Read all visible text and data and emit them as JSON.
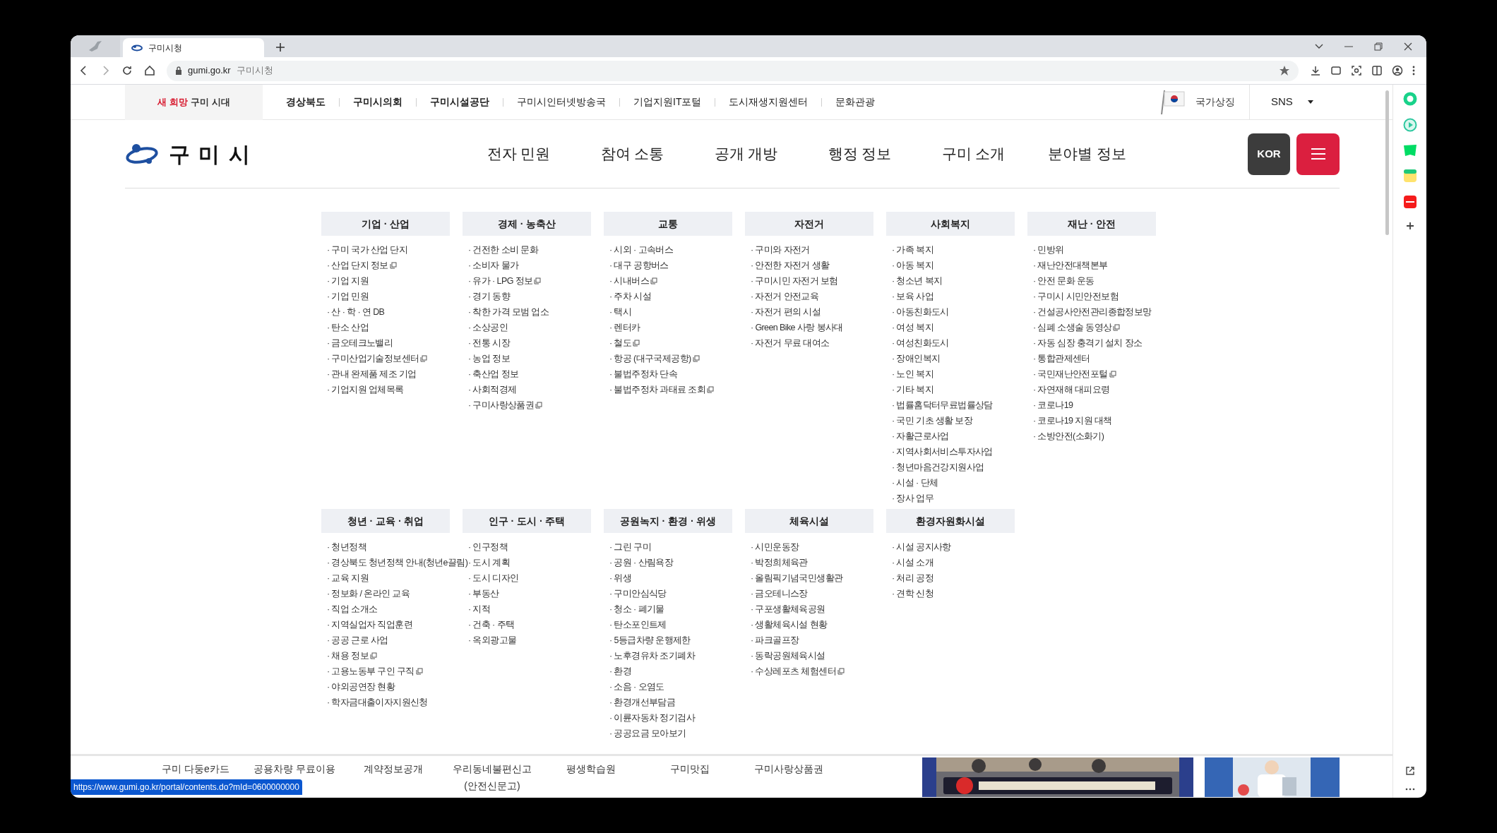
{
  "browser": {
    "tab_title": "구미시청",
    "url_host": "gumi.go.kr",
    "url_title": "구미시청",
    "status_url": "https://www.gumi.go.kr/portal/contents.do?mId=0600000000"
  },
  "top_bar": {
    "logo_red": "새 희망",
    "logo_dark": "구미 시대",
    "links": [
      "경상북도",
      "구미시의회",
      "구미시설공단",
      "구미시인터넷방송국",
      "기업지원IT포털",
      "도시재생지원센터",
      "문화관광"
    ],
    "national_symbol": "국가상징",
    "sns": "SNS"
  },
  "header": {
    "logo": "구 미 시",
    "nav": [
      "전자 민원",
      "참여 소통",
      "공개 개방",
      "행정 정보",
      "구미 소개",
      "분야별 정보"
    ],
    "language": "KOR"
  },
  "menu": [
    {
      "title": "기업 · 산업",
      "items": [
        {
          "label": "· 구미 국가 산업 단지",
          "external": false
        },
        {
          "label": "· 산업 단지 정보",
          "external": true
        },
        {
          "label": "· 기업 지원",
          "external": false
        },
        {
          "label": "· 기업 민원",
          "external": false
        },
        {
          "label": "· 산 · 학 · 연 DB",
          "external": false
        },
        {
          "label": "· 탄소 산업",
          "external": false
        },
        {
          "label": "· 금오테크노밸리",
          "external": false
        },
        {
          "label": "· 구미산업기술정보센터",
          "external": true
        },
        {
          "label": "· 관내 완제품 제조 기업",
          "external": false
        },
        {
          "label": "· 기업지원 업체목록",
          "external": false
        }
      ]
    },
    {
      "title": "경제 · 농축산",
      "items": [
        {
          "label": "· 건전한 소비 문화",
          "external": false
        },
        {
          "label": "· 소비자 물가",
          "external": false
        },
        {
          "label": "· 유가 · LPG 정보",
          "external": true
        },
        {
          "label": "· 경기 동향",
          "external": false
        },
        {
          "label": "· 착한 가격 모범 업소",
          "external": false
        },
        {
          "label": "· 소상공인",
          "external": false
        },
        {
          "label": "· 전통 시장",
          "external": false
        },
        {
          "label": "· 농업 정보",
          "external": false
        },
        {
          "label": "· 축산업 정보",
          "external": false
        },
        {
          "label": "· 사회적경제",
          "external": false
        },
        {
          "label": "· 구미사랑상품권",
          "external": true
        }
      ]
    },
    {
      "title": "교통",
      "items": [
        {
          "label": "· 시외 · 고속버스",
          "external": false
        },
        {
          "label": "· 대구 공항버스",
          "external": false
        },
        {
          "label": "· 시내버스",
          "external": true
        },
        {
          "label": "· 주차 시설",
          "external": false
        },
        {
          "label": "· 택시",
          "external": false
        },
        {
          "label": "· 렌터카",
          "external": false
        },
        {
          "label": "· 철도",
          "external": true
        },
        {
          "label": "· 항공 (대구국제공항)",
          "external": true
        },
        {
          "label": "· 불법주정차 단속",
          "external": false
        },
        {
          "label": "· 불법주정차 과태료 조회",
          "external": true
        }
      ]
    },
    {
      "title": "자전거",
      "items": [
        {
          "label": "· 구미와 자전거",
          "external": false
        },
        {
          "label": "· 안전한 자전거 생활",
          "external": false
        },
        {
          "label": "· 구미시민 자전거 보험",
          "external": false
        },
        {
          "label": "· 자전거 안전교육",
          "external": false
        },
        {
          "label": "· 자전거 편의 시설",
          "external": false
        },
        {
          "label": "· Green Bike 사랑 봉사대",
          "external": false
        },
        {
          "label": "· 자전거 무료 대여소",
          "external": false
        }
      ]
    },
    {
      "title": "사회복지",
      "items": [
        {
          "label": "· 가족 복지",
          "external": false
        },
        {
          "label": "· 아동 복지",
          "external": false
        },
        {
          "label": "· 청소년 복지",
          "external": false
        },
        {
          "label": "· 보육 사업",
          "external": false
        },
        {
          "label": "· 아동친화도시",
          "external": false
        },
        {
          "label": "· 여성 복지",
          "external": false
        },
        {
          "label": "· 여성친화도시",
          "external": false
        },
        {
          "label": "· 장애인복지",
          "external": false
        },
        {
          "label": "· 노인 복지",
          "external": false
        },
        {
          "label": "· 기타 복지",
          "external": false
        },
        {
          "label": "· 법률홈닥터무료법률상담",
          "external": false
        },
        {
          "label": "· 국민 기초 생활 보장",
          "external": false
        },
        {
          "label": "· 자활근로사업",
          "external": false
        },
        {
          "label": "· 지역사회서비스투자사업",
          "external": false
        },
        {
          "label": "· 청년마음건강지원사업",
          "external": false
        },
        {
          "label": "· 시설 · 단체",
          "external": false
        },
        {
          "label": "· 장사 업무",
          "external": false
        }
      ]
    },
    {
      "title": "재난 · 안전",
      "items": [
        {
          "label": "· 민방위",
          "external": false
        },
        {
          "label": "· 재난안전대책본부",
          "external": false
        },
        {
          "label": "· 안전 문화 운동",
          "external": false
        },
        {
          "label": "· 구미시 시민안전보험",
          "external": false
        },
        {
          "label": "· 건설공사안전관리종합정보망",
          "external": false
        },
        {
          "label": "· 심폐 소생술 동영상",
          "external": true
        },
        {
          "label": "· 자동 심장 충격기 설치 장소",
          "external": false
        },
        {
          "label": "· 통합관제센터",
          "external": false
        },
        {
          "label": "· 국민재난안전포털",
          "external": true
        },
        {
          "label": "· 자연재해 대피요령",
          "external": false
        },
        {
          "label": "· 코로나19",
          "external": false
        },
        {
          "label": "· 코로나19 지원 대책",
          "external": false
        },
        {
          "label": "· 소방안전(소화기)",
          "external": false
        }
      ]
    },
    {
      "title": "청년 · 교육 · 취업",
      "items": [
        {
          "label": "· 청년정책",
          "external": false
        },
        {
          "label": "· 경상북도 청년정책 안내(청년e끌림)",
          "external": false
        },
        {
          "label": "· 교육 지원",
          "external": false
        },
        {
          "label": "· 정보화 / 온라인 교육",
          "external": false
        },
        {
          "label": "· 직업 소개소",
          "external": false
        },
        {
          "label": "· 지역실업자 직업훈련",
          "external": false
        },
        {
          "label": "· 공공 근로 사업",
          "external": false
        },
        {
          "label": "· 채용 정보",
          "external": true
        },
        {
          "label": "· 고용노동부 구인 구직",
          "external": true
        },
        {
          "label": "· 야외공연장 현황",
          "external": false
        },
        {
          "label": "· 학자금대출이자지원신청",
          "external": false
        }
      ]
    },
    {
      "title": "인구 · 도시 · 주택",
      "items": [
        {
          "label": "· 인구정책",
          "external": false
        },
        {
          "label": "· 도시 계획",
          "external": false
        },
        {
          "label": "· 도시 디자인",
          "external": false
        },
        {
          "label": "· 부동산",
          "external": false
        },
        {
          "label": "· 지적",
          "external": false
        },
        {
          "label": "· 건축 · 주택",
          "external": false
        },
        {
          "label": "· 옥외광고물",
          "external": false
        }
      ]
    },
    {
      "title": "공원녹지 · 환경 · 위생",
      "items": [
        {
          "label": "· 그린 구미",
          "external": false
        },
        {
          "label": "· 공원 · 산림욕장",
          "external": false
        },
        {
          "label": "· 위생",
          "external": false
        },
        {
          "label": "· 구미안심식당",
          "external": false
        },
        {
          "label": "· 청소 · 폐기물",
          "external": false
        },
        {
          "label": "· 탄소포인트제",
          "external": false
        },
        {
          "label": "· 5등급차량 운행제한",
          "external": false
        },
        {
          "label": "· 노후경유차 조기폐차",
          "external": false
        },
        {
          "label": "· 환경",
          "external": false
        },
        {
          "label": "· 소음 · 오염도",
          "external": false
        },
        {
          "label": "· 환경개선부담금",
          "external": false
        },
        {
          "label": "· 이륜자동차 정기검사",
          "external": false
        },
        {
          "label": "· 공공요금 모아보기",
          "external": false
        }
      ]
    },
    {
      "title": "체육시설",
      "items": [
        {
          "label": "· 시민운동장",
          "external": false
        },
        {
          "label": "· 박정희체육관",
          "external": false
        },
        {
          "label": "· 올림픽기념국민생활관",
          "external": false
        },
        {
          "label": "· 금오테니스장",
          "external": false
        },
        {
          "label": "· 구포생활체육공원",
          "external": false
        },
        {
          "label": "· 생활체육시설 현황",
          "external": false
        },
        {
          "label": "· 파크골프장",
          "external": false
        },
        {
          "label": "· 동락공원체육시설",
          "external": false
        },
        {
          "label": "· 수상레포츠 체험센터",
          "external": true
        }
      ]
    },
    {
      "title": "환경자원화시설",
      "items": [
        {
          "label": "· 시설 공지사항",
          "external": false
        },
        {
          "label": "· 시설 소개",
          "external": false
        },
        {
          "label": "· 처리 공정",
          "external": false
        },
        {
          "label": "· 견학 신청",
          "external": false
        }
      ]
    }
  ],
  "footer_links": [
    "구미 다둥e카드",
    "공용차량 무료이용",
    "계약정보공개",
    "우리동네불편신고\n(안전신문고)",
    "평생학습원",
    "구미맛집",
    "구미사랑상품권"
  ]
}
